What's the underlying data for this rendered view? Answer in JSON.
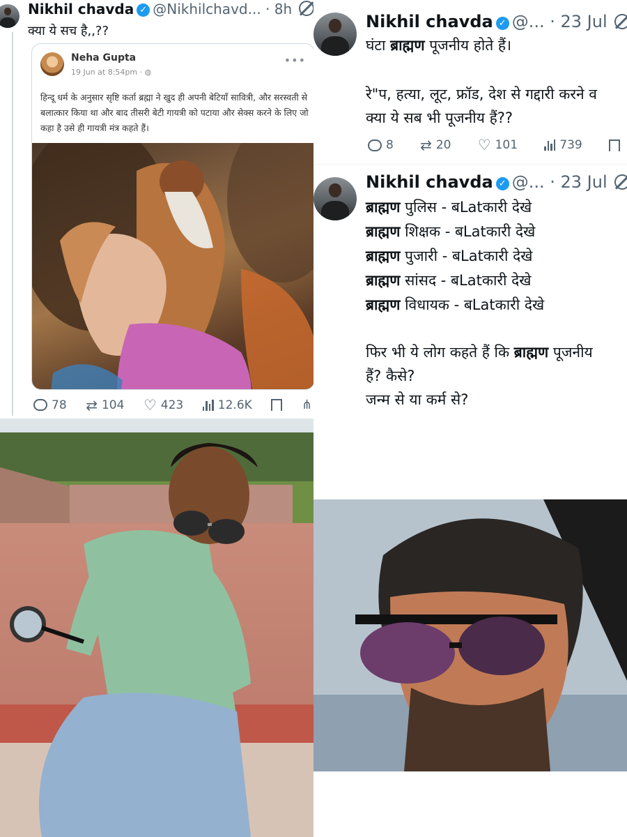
{
  "tweet1": {
    "author": "Nikhil chavda",
    "handle": "@Nikhilchavd...",
    "time": "· 8h",
    "text": "क्या ये सच है,,??",
    "quoted": {
      "author": "Neha Gupta",
      "date": "19 Jun at 8:54pm · ",
      "text": "हिन्दू धर्म के अनुसार सृष्टि कर्ता ब्रह्मा ने खुद ही अपनी बेटियाँ सावित्री, और सरस्वती से बलात्कार किया था और बाद तीसरी बेटी गायत्री को पटाया और सेक्स करने के लिए जो कहा है उसे ही गायत्री मंत्र कहते हैं।"
    },
    "stats": {
      "replies": "78",
      "reposts": "104",
      "likes": "423",
      "views": "12.6K"
    }
  },
  "tweet2": {
    "author": "Nikhil chavda",
    "handle": "@...",
    "time": "· 23 Jul",
    "line1_pre": "घंटा ",
    "line1_bold": "ब्राह्मण",
    "line1_post": " पूजनीय होते हैं।",
    "line2": "रे\"प, हत्या, लूट, फ्रॉड, देश से गद्दारी करने व",
    "line3": "क्या ये सब भी पूजनीय हैं??",
    "stats": {
      "replies": "8",
      "reposts": "20",
      "likes": "101",
      "views": "739"
    }
  },
  "tweet3": {
    "author": "Nikhil chavda",
    "handle": "@...",
    "time": "· 23 Jul",
    "lines": [
      {
        "bold": "ब्राह्मण",
        "rest": " पुलिस - बLatकारी देखे"
      },
      {
        "bold": "ब्राह्मण",
        "rest": " शिक्षक - बLatकारी देखे"
      },
      {
        "bold": "ब्राह्मण",
        "rest": " पुजारी -  बLatकारी देखे"
      },
      {
        "bold": "ब्राह्मण",
        "rest": " सांसद - बLatकारी देखे"
      },
      {
        "bold": "ब्राह्मण",
        "rest": " विधायक - बLatकारी देखे"
      }
    ],
    "closing_pre": "फिर भी ये लोग कहते हैं कि ",
    "closing_bold": "ब्राह्मण",
    "closing_post": " पूजनीय",
    "closing_line2": "हैं? कैसे?",
    "closing_line3": "जन्म से या कर्म से?"
  },
  "icons": [
    "verified-badge-icon",
    "grok-icon",
    "reply-icon",
    "repost-icon",
    "like-icon",
    "views-icon",
    "bookmark-icon",
    "share-icon",
    "more-options-icon",
    "globe-icon"
  ],
  "colors": {
    "verified": "#1d9bf0",
    "muted_text": "#536471",
    "text": "#0f1419",
    "card_border": "#cfd9de"
  }
}
